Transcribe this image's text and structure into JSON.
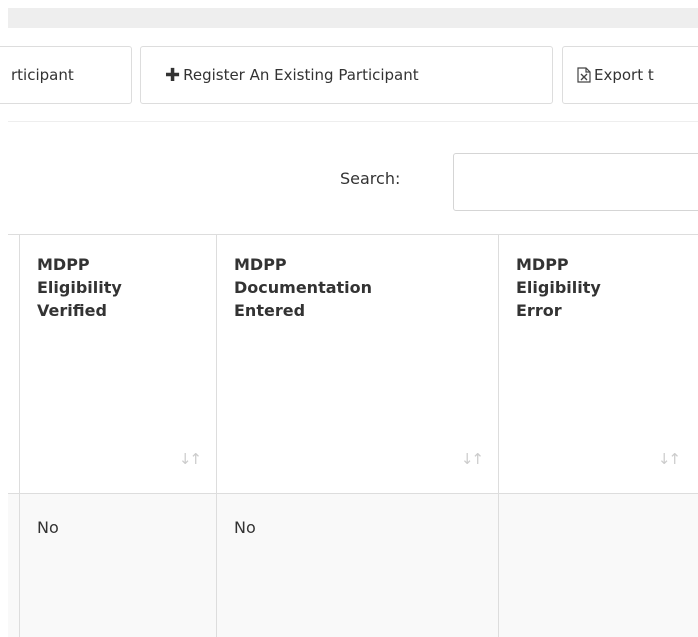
{
  "toolbar": {
    "add_participant_label": "rticipant",
    "register_existing_label": "Register An Existing Participant",
    "export_label": "Export t"
  },
  "search": {
    "label": "Search:",
    "value": ""
  },
  "table": {
    "columns": [
      {
        "line1": "MDPP",
        "line2": "Eligibility",
        "line3": "Verified"
      },
      {
        "line1": "MDPP",
        "line2": "Documentation",
        "line3": "Entered"
      },
      {
        "line1": "MDPP",
        "line2": "Eligibility",
        "line3": "Error"
      }
    ],
    "rows": [
      {
        "cells": [
          "No",
          "No",
          ""
        ]
      }
    ]
  },
  "icons": {
    "plus": "plus-icon",
    "excel": "excel-file-icon",
    "sort": "sort-icon"
  }
}
